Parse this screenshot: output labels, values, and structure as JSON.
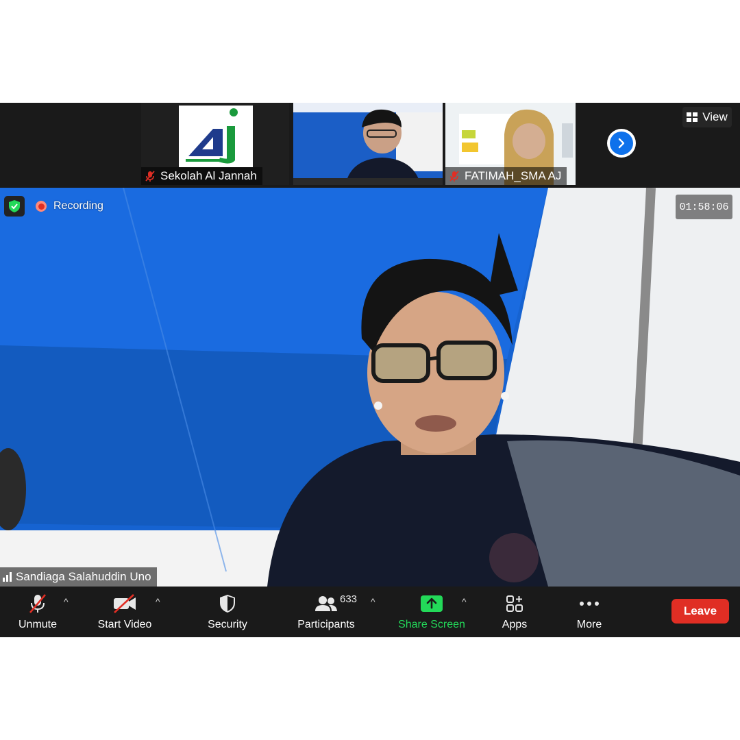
{
  "thumbnails": [
    {
      "name": "Sekolah Al Jannah",
      "logo_text": "AJ",
      "muted": true
    },
    {
      "name": "",
      "muted": false
    },
    {
      "name": "FATIMAH_SMA AJ",
      "muted": true
    }
  ],
  "view_label": "View",
  "recording_label": "Recording",
  "timer": "01:58:06",
  "active_speaker": "Sandiaga Salahuddin Uno",
  "toolbar": {
    "unmute_label": "Unmute",
    "start_video_label": "Start Video",
    "security_label": "Security",
    "participants_label": "Participants",
    "participant_count": "633",
    "share_screen_label": "Share Screen",
    "apps_label": "Apps",
    "more_label": "More",
    "leave_label": "Leave"
  },
  "colors": {
    "share_screen": "#23d959",
    "leave": "#e02e24",
    "next_page": "#0e71eb",
    "security_shield": "#23d959",
    "muted_red": "#e02e24"
  },
  "icons": [
    "muted-mic-icon",
    "view-grid-icon",
    "chevron-right-icon",
    "encryption-shield-icon",
    "recording-dot-icon",
    "signal-bars-icon",
    "mic-off-icon",
    "video-off-icon",
    "security-shield-icon",
    "participants-icon",
    "share-screen-icon",
    "apps-icon",
    "more-dots-icon",
    "caret-up-icon"
  ]
}
